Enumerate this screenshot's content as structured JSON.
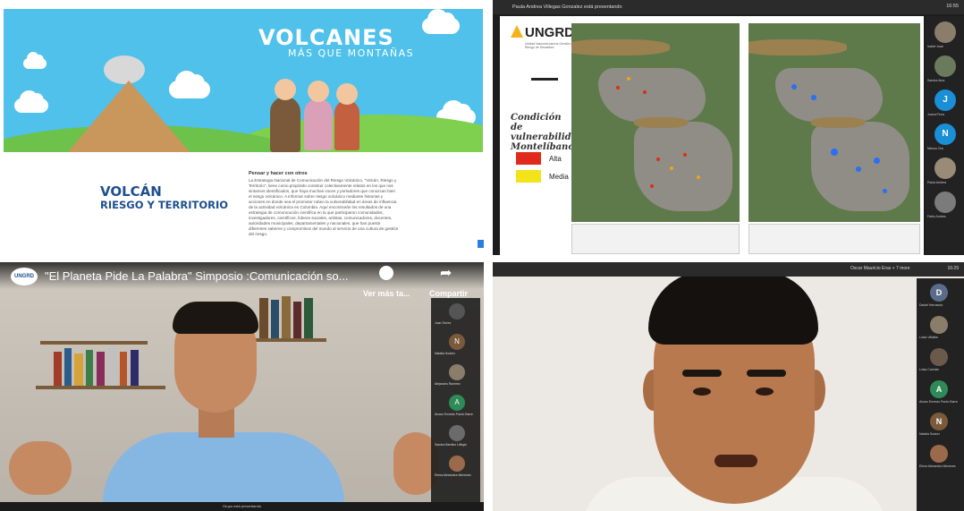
{
  "slide": {
    "title": "VOLCANES",
    "subtitle": "MÁS QUE MONTAÑAS",
    "section_title": "VOLCÁN",
    "section_subtitle": "RIESGO Y TERRITORIO",
    "para_head": "Pensar y hacer con otros",
    "para_body": "La Estrategia Nacional de Comunicación del Riesgo Volcánico, \"Volcán, Riesgo y Territorio\", tiene como propósito construir colectivamente relatos en los que nos sintamos identificados, que haya muchas voces y portadores que conozcan bien el riesgo volcánico. A informar sobre riesgo volcánico mediante historias y acciones en donde sea el promotor rubeo la vulnerabilidad en áreas de influencia de la actividad volcánica en Colombia. Aquí encontrarán los resultados de una estrategia de comunicación científica en la que participaron comunidades, investigadores, científicos, líderes sociales, artistas, comunicadores, docentes, autoridades municipales, departamentales y nacionales, que han puesto diferentes saberes y compromisos del mundo al servicio de una cultura de gestión del riesgo."
  },
  "map_presentation": {
    "presenter_bar": "Paula Andrea Villegas Gonzalez está presentando",
    "time": "16:55",
    "logo": "UNGRD",
    "logo_sub": "Unidad Nacional para la Gestión del Riesgo de Desastres",
    "heading": "Condición de vulnerabilidad: Montelíbano",
    "legend": [
      {
        "label": "Alta",
        "color": "#e02b1c"
      },
      {
        "label": "Media",
        "color": "#f2e31a"
      }
    ],
    "participants": [
      {
        "initial": "",
        "name": "Isabel Juan"
      },
      {
        "initial": "",
        "name": "Sandra Ama"
      },
      {
        "initial": "J",
        "name": "Juana Pena"
      },
      {
        "initial": "N",
        "name": "Nelson Ora"
      },
      {
        "initial": "",
        "name": "Paula Andrea"
      },
      {
        "initial": "",
        "name": "Fabio Andres"
      }
    ]
  },
  "video_call": {
    "logo": "UNGRD",
    "title": "\"El Planeta Pide La Palabra\" Simposio :Comunicación so...",
    "watch_later": "Ver más ta...",
    "share": "Compartir",
    "bottom_status": "Grupo está presentando",
    "participants": [
      {
        "initial": "",
        "name": "Juan Torres"
      },
      {
        "initial": "N",
        "name": "Natalia Suárez"
      },
      {
        "initial": "",
        "name": "Alejandro Ramirez"
      },
      {
        "initial": "A",
        "name": "Alvaro Ernesto Pardo Barre"
      },
      {
        "initial": "",
        "name": "Sandra Benítez Lillegio"
      },
      {
        "initial": "",
        "name": "Elena Alexandra Meneses"
      }
    ]
  },
  "video_call_2": {
    "presenter_bar": "Oscar Mauricio Eras + 7 more",
    "time": "16:29",
    "participants": [
      {
        "initial": "D",
        "name": "Daniel Hernando"
      },
      {
        "initial": "",
        "name": "Luisa Villalba"
      },
      {
        "initial": "",
        "name": "Luisa Carlotta"
      },
      {
        "initial": "A",
        "name": "Alvaro Ernesto Pardo Barre"
      },
      {
        "initial": "N",
        "name": "Natalia Suárez"
      },
      {
        "initial": "",
        "name": "Elena Alexandra Meneses"
      }
    ]
  }
}
